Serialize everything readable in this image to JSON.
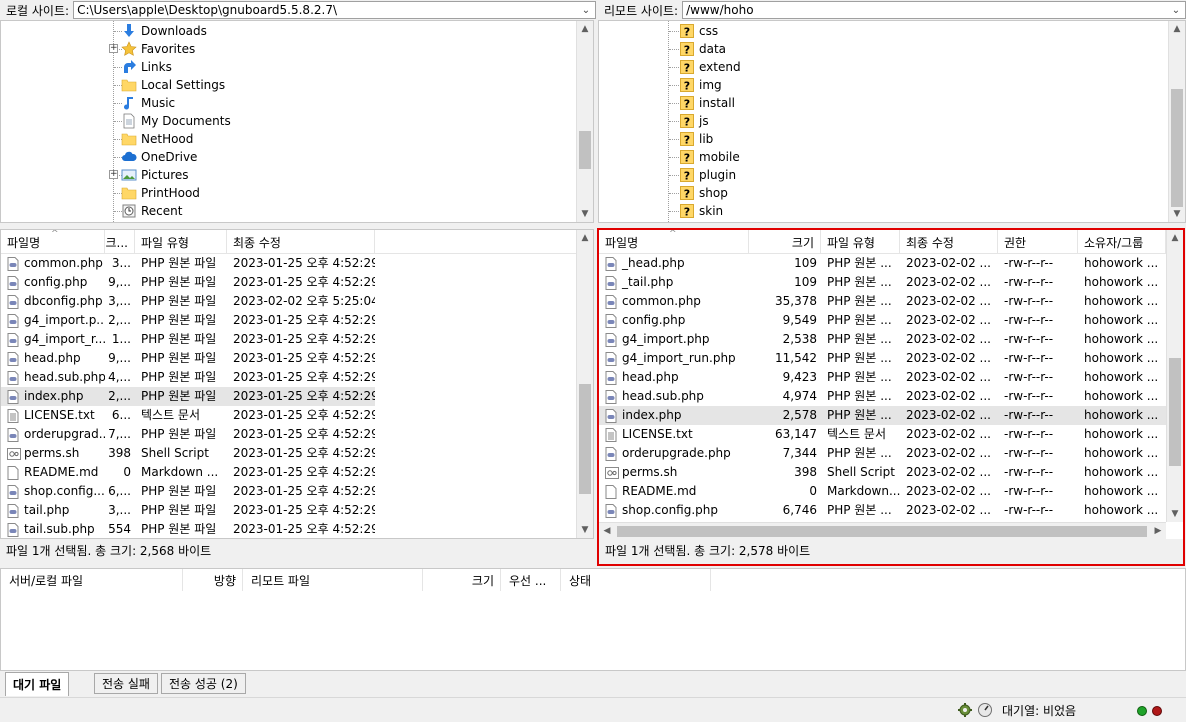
{
  "local": {
    "site_label": "로컬 사이트:",
    "site_path": "C:\\Users\\apple\\Desktop\\gnuboard5.5.8.2.7\\",
    "tree": [
      {
        "label": "Downloads",
        "icon": "download-arrow-icon",
        "expandable": false
      },
      {
        "label": "Favorites",
        "icon": "star-icon",
        "expandable": true
      },
      {
        "label": "Links",
        "icon": "link-arrow-icon",
        "expandable": false
      },
      {
        "label": "Local Settings",
        "icon": "folder-icon",
        "expandable": false
      },
      {
        "label": "Music",
        "icon": "music-note-icon",
        "expandable": false
      },
      {
        "label": "My Documents",
        "icon": "document-icon",
        "expandable": false
      },
      {
        "label": "NetHood",
        "icon": "folder-icon",
        "expandable": false
      },
      {
        "label": "OneDrive",
        "icon": "cloud-icon",
        "expandable": false
      },
      {
        "label": "Pictures",
        "icon": "pictures-icon",
        "expandable": true
      },
      {
        "label": "PrintHood",
        "icon": "folder-icon",
        "expandable": false
      },
      {
        "label": "Recent",
        "icon": "recent-icon",
        "expandable": false
      }
    ],
    "columns": [
      "파일명",
      "크...",
      "파일 유형",
      "최종 수정"
    ],
    "files": [
      {
        "name": "common.php",
        "size": "3...",
        "type": "PHP 원본 파일",
        "modified": "2023-01-25 오후 4:52:29",
        "icon": "php-file-icon"
      },
      {
        "name": "config.php",
        "size": "9,...",
        "type": "PHP 원본 파일",
        "modified": "2023-01-25 오후 4:52:29",
        "icon": "php-file-icon"
      },
      {
        "name": "dbconfig.php",
        "size": "3,...",
        "type": "PHP 원본 파일",
        "modified": "2023-02-02 오후 5:25:04",
        "icon": "php-file-icon"
      },
      {
        "name": "g4_import.p...",
        "size": "2,...",
        "type": "PHP 원본 파일",
        "modified": "2023-01-25 오후 4:52:29",
        "icon": "php-file-icon"
      },
      {
        "name": "g4_import_r...",
        "size": "1...",
        "type": "PHP 원본 파일",
        "modified": "2023-01-25 오후 4:52:29",
        "icon": "php-file-icon"
      },
      {
        "name": "head.php",
        "size": "9,...",
        "type": "PHP 원본 파일",
        "modified": "2023-01-25 오후 4:52:29",
        "icon": "php-file-icon"
      },
      {
        "name": "head.sub.php",
        "size": "4,...",
        "type": "PHP 원본 파일",
        "modified": "2023-01-25 오후 4:52:29",
        "icon": "php-file-icon"
      },
      {
        "name": "index.php",
        "size": "2,...",
        "type": "PHP 원본 파일",
        "modified": "2023-01-25 오후 4:52:29",
        "icon": "php-file-icon",
        "selected": true
      },
      {
        "name": "LICENSE.txt",
        "size": "6...",
        "type": "텍스트 문서",
        "modified": "2023-01-25 오후 4:52:29",
        "icon": "text-file-icon"
      },
      {
        "name": "orderupgrad...",
        "size": "7,...",
        "type": "PHP 원본 파일",
        "modified": "2023-01-25 오후 4:52:29",
        "icon": "php-file-icon"
      },
      {
        "name": "perms.sh",
        "size": "398",
        "type": "Shell Script",
        "modified": "2023-01-25 오후 4:52:29",
        "icon": "shell-file-icon"
      },
      {
        "name": "README.md",
        "size": "0",
        "type": "Markdown ...",
        "modified": "2023-01-25 오후 4:52:29",
        "icon": "markdown-file-icon"
      },
      {
        "name": "shop.config....",
        "size": "6,...",
        "type": "PHP 원본 파일",
        "modified": "2023-01-25 오후 4:52:29",
        "icon": "php-file-icon"
      },
      {
        "name": "tail.php",
        "size": "3,...",
        "type": "PHP 원본 파일",
        "modified": "2023-01-25 오후 4:52:29",
        "icon": "php-file-icon"
      },
      {
        "name": "tail.sub.php",
        "size": "554",
        "type": "PHP 원본 파일",
        "modified": "2023-01-25 오후 4:52:29",
        "icon": "php-file-icon"
      }
    ],
    "status": "파일 1개 선택됨. 총 크기: 2,568 바이트"
  },
  "remote": {
    "site_label": "리모트 사이트:",
    "site_path": "/www/hoho",
    "tree": [
      {
        "label": "css",
        "icon": "question-folder-icon"
      },
      {
        "label": "data",
        "icon": "question-folder-icon"
      },
      {
        "label": "extend",
        "icon": "question-folder-icon"
      },
      {
        "label": "img",
        "icon": "question-folder-icon"
      },
      {
        "label": "install",
        "icon": "question-folder-icon"
      },
      {
        "label": "js",
        "icon": "question-folder-icon"
      },
      {
        "label": "lib",
        "icon": "question-folder-icon"
      },
      {
        "label": "mobile",
        "icon": "question-folder-icon"
      },
      {
        "label": "plugin",
        "icon": "question-folder-icon"
      },
      {
        "label": "shop",
        "icon": "question-folder-icon"
      },
      {
        "label": "skin",
        "icon": "question-folder-icon"
      }
    ],
    "columns": [
      "파일명",
      "크기",
      "파일 유형",
      "최종 수정",
      "권한",
      "소유자/그룹"
    ],
    "files": [
      {
        "name": "_head.php",
        "size": "109",
        "type": "PHP 원본 ...",
        "modified": "2023-02-02 ...",
        "perm": "-rw-r--r--",
        "owner": "hohowork ...",
        "icon": "php-file-icon"
      },
      {
        "name": "_tail.php",
        "size": "109",
        "type": "PHP 원본 ...",
        "modified": "2023-02-02 ...",
        "perm": "-rw-r--r--",
        "owner": "hohowork ...",
        "icon": "php-file-icon"
      },
      {
        "name": "common.php",
        "size": "35,378",
        "type": "PHP 원본 ...",
        "modified": "2023-02-02 ...",
        "perm": "-rw-r--r--",
        "owner": "hohowork ...",
        "icon": "php-file-icon"
      },
      {
        "name": "config.php",
        "size": "9,549",
        "type": "PHP 원본 ...",
        "modified": "2023-02-02 ...",
        "perm": "-rw-r--r--",
        "owner": "hohowork ...",
        "icon": "php-file-icon"
      },
      {
        "name": "g4_import.php",
        "size": "2,538",
        "type": "PHP 원본 ...",
        "modified": "2023-02-02 ...",
        "perm": "-rw-r--r--",
        "owner": "hohowork ...",
        "icon": "php-file-icon"
      },
      {
        "name": "g4_import_run.php",
        "size": "11,542",
        "type": "PHP 원본 ...",
        "modified": "2023-02-02 ...",
        "perm": "-rw-r--r--",
        "owner": "hohowork ...",
        "icon": "php-file-icon"
      },
      {
        "name": "head.php",
        "size": "9,423",
        "type": "PHP 원본 ...",
        "modified": "2023-02-02 ...",
        "perm": "-rw-r--r--",
        "owner": "hohowork ...",
        "icon": "php-file-icon"
      },
      {
        "name": "head.sub.php",
        "size": "4,974",
        "type": "PHP 원본 ...",
        "modified": "2023-02-02 ...",
        "perm": "-rw-r--r--",
        "owner": "hohowork ...",
        "icon": "php-file-icon"
      },
      {
        "name": "index.php",
        "size": "2,578",
        "type": "PHP 원본 ...",
        "modified": "2023-02-02 ...",
        "perm": "-rw-r--r--",
        "owner": "hohowork ...",
        "icon": "php-file-icon",
        "selected": true
      },
      {
        "name": "LICENSE.txt",
        "size": "63,147",
        "type": "텍스트 문서",
        "modified": "2023-02-02 ...",
        "perm": "-rw-r--r--",
        "owner": "hohowork ...",
        "icon": "text-file-icon"
      },
      {
        "name": "orderupgrade.php",
        "size": "7,344",
        "type": "PHP 원본 ...",
        "modified": "2023-02-02 ...",
        "perm": "-rw-r--r--",
        "owner": "hohowork ...",
        "icon": "php-file-icon"
      },
      {
        "name": "perms.sh",
        "size": "398",
        "type": "Shell Script",
        "modified": "2023-02-02 ...",
        "perm": "-rw-r--r--",
        "owner": "hohowork ...",
        "icon": "shell-file-icon"
      },
      {
        "name": "README.md",
        "size": "0",
        "type": "Markdown...",
        "modified": "2023-02-02 ...",
        "perm": "-rw-r--r--",
        "owner": "hohowork ...",
        "icon": "markdown-file-icon"
      },
      {
        "name": "shop.config.php",
        "size": "6,746",
        "type": "PHP 원본 ...",
        "modified": "2023-02-02 ...",
        "perm": "-rw-r--r--",
        "owner": "hohowork ...",
        "icon": "php-file-icon"
      }
    ],
    "status": "파일 1개 선택됨. 총 크기: 2,578 바이트"
  },
  "queue": {
    "columns": [
      "서버/로컬 파일",
      "방향",
      "리모트 파일",
      "크기",
      "우선 ...",
      "상태"
    ]
  },
  "tabs": [
    {
      "label": "대기 파일",
      "active": true
    },
    {
      "label": "전송 실패",
      "active": false
    },
    {
      "label": "전송 성공 (2)",
      "active": false
    }
  ],
  "statusbar": {
    "queue_text": "대기열: 비었음",
    "icons": [
      "settings-gear-icon",
      "speed-limit-icon",
      "green-led-icon",
      "red-led-icon"
    ]
  },
  "colors": {
    "highlight_border": "#e00000",
    "selection": "#e5e5e5"
  }
}
